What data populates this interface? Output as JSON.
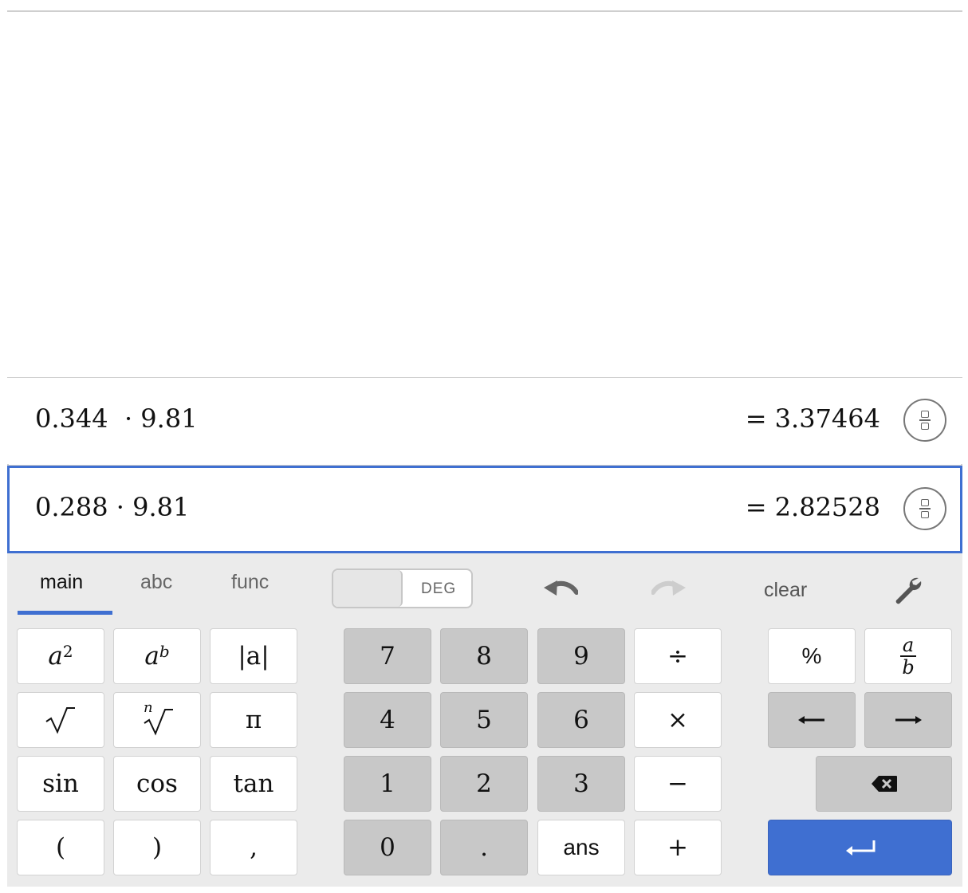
{
  "expressions": [
    {
      "input": "0.344  · 9.81",
      "result": "= 3.37464"
    },
    {
      "input": "0.288 · 9.81",
      "result": "= 2.82528"
    }
  ],
  "keypad": {
    "tabs": [
      "main",
      "abc",
      "func"
    ],
    "active_tab": "main",
    "angle_mode": "DEG",
    "clear_label": "clear",
    "keys": {
      "square": "a",
      "square_exp": "2",
      "power": "a",
      "power_exp": "b",
      "abs": "|a|",
      "nroot_index": "n",
      "pi": "π",
      "sin": "sin",
      "cos": "cos",
      "tan": "tan",
      "lparen": "(",
      "rparen": ")",
      "comma": ",",
      "d7": "7",
      "d8": "8",
      "d9": "9",
      "d4": "4",
      "d5": "5",
      "d6": "6",
      "d1": "1",
      "d2": "2",
      "d3": "3",
      "d0": "0",
      "dot": ".",
      "ans": "ans",
      "divide": "÷",
      "times": "×",
      "minus": "−",
      "plus": "+",
      "percent": "%",
      "frac_num": "a",
      "frac_den": "b",
      "left": "⟵",
      "right": "⟶"
    },
    "colors": {
      "accent": "#3f6fd1",
      "digit_key": "#c8c8c8",
      "panel": "#ebebeb"
    }
  }
}
